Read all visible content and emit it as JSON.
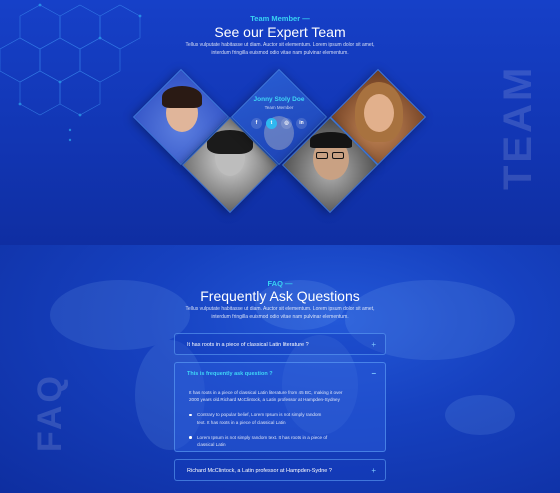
{
  "team": {
    "kicker": "Team Member —",
    "title": "See our Expert Team",
    "desc_line1": "Tellus vulputate habitasse ut diam. Auctor sit elementum. Lorem ipsum dolor sit amet,",
    "desc_line2": "interdum fringilla euismod odio vitae nam pulvinar elementum.",
    "side_word": "TEAM",
    "featured_member": {
      "name": "Jonny Stoly Doe",
      "role": "Team Member",
      "socials": [
        {
          "icon": "facebook-icon",
          "glyph": "f"
        },
        {
          "icon": "twitter-icon",
          "glyph": "t"
        },
        {
          "icon": "instagram-icon",
          "glyph": "◎"
        },
        {
          "icon": "linkedin-icon",
          "glyph": "in"
        }
      ]
    }
  },
  "faq": {
    "kicker": "FAQ —",
    "title": "Frequently Ask Questions",
    "desc_line1": "Tellus vulputate habitasse ut diam. Auctor sit elementum. Lorem ipsum dolor sit amet,",
    "desc_line2": "interdum fringilla euismod odio vitae nam pulvinar elementum.",
    "side_word": "FAQ",
    "items": [
      {
        "question": "It has roots in a piece of classical Latin literature ?",
        "toggle": "+"
      },
      {
        "question": "This is frequently ask question ?",
        "toggle": "−",
        "answer": "It has roots in a piece of classical Latin literature from 45 BC, making it over 2000 years old.Richard McClintock, a Latin professor at Hampden-Sydney",
        "bullets": [
          "Contrary to popular belief, Lorem Ipsum is not simply random text. It has roots in a piece of classical Latin",
          "Lorem Ipsum is not simply random text. It has roots in a piece of classical Latin"
        ]
      },
      {
        "question": "Richard McClintock, a Latin professor at Hampden-Sydne ?",
        "toggle": "+"
      }
    ]
  },
  "colors": {
    "accent": "#3fd7f7",
    "bg_dark": "#0b2a9a",
    "bg_mid": "#1640c8"
  }
}
